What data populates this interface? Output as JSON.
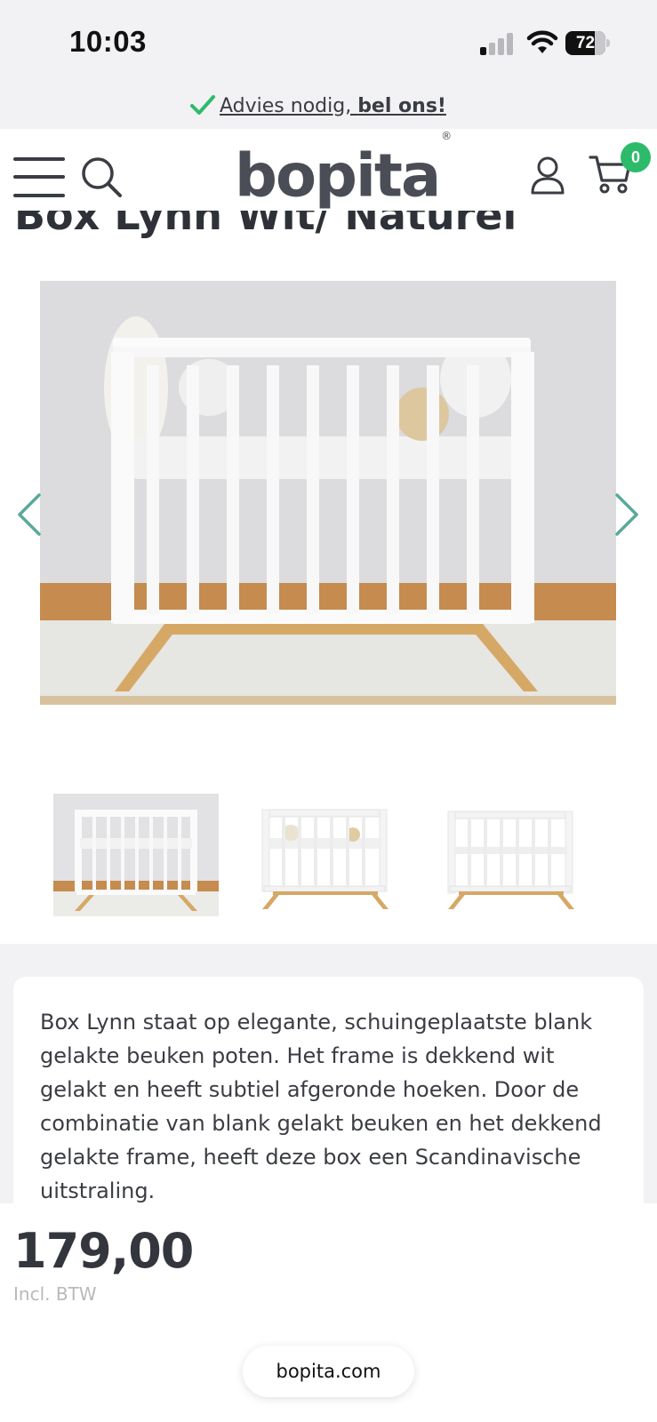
{
  "status_bar": {
    "time": "10:03",
    "battery": "72"
  },
  "advice_banner": {
    "text": "Advies nodig, ",
    "cta": "bel ons!"
  },
  "header": {
    "logo": "bopita",
    "logo_mark": "®",
    "cart_count": "0"
  },
  "product": {
    "title": "Box Lynn Wit/ Naturel",
    "description": "Box Lynn staat op elegante, schuingeplaatste blank gelakte beuken poten. Het frame is dekkend wit gelakt en heeft subtiel afgeronde hoeken. Door de combinatie van blank gelakt beuken en het dekkend gelakte frame, heeft deze box een Scandinavische uitstraling.",
    "price": "179,00",
    "vat_label": "Incl. BTW"
  },
  "browser": {
    "url": "bopita.com"
  },
  "colors": {
    "accent_green": "#2dbb6b",
    "arrow_teal": "#5aa99a",
    "text_dark": "#3b3d44"
  }
}
